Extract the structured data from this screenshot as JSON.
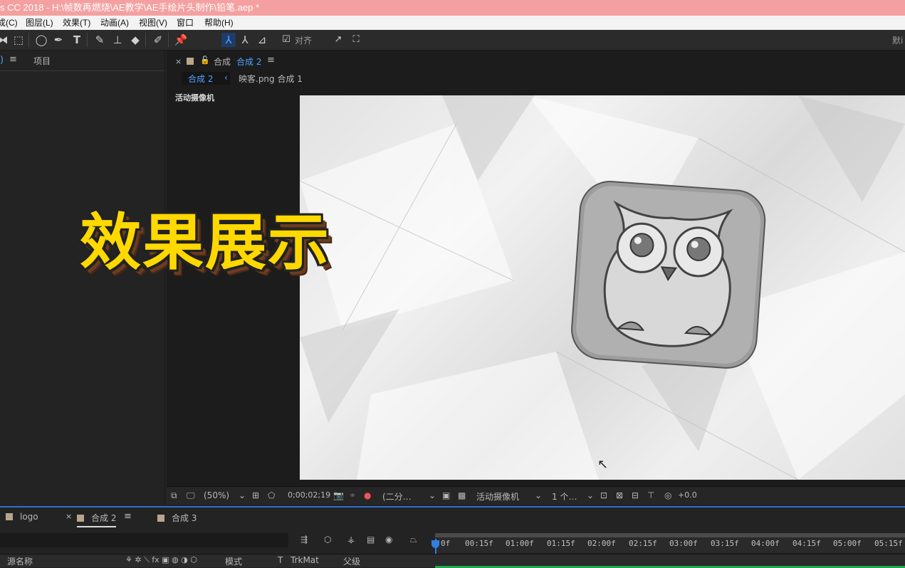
{
  "window": {
    "title": "s CC 2018 - H:\\帧数再燃烧\\AE教学\\AE手绘片头制作\\铅笔.aep *"
  },
  "menu": [
    "成(C)",
    "图层(L)",
    "效果(T)",
    "动画(A)",
    "视图(V)",
    "窗口",
    "帮助(H)"
  ],
  "toolbar": {
    "snap_label": "对齐",
    "right_label": "默i"
  },
  "left_panel": {
    "tab_label": "项目"
  },
  "comp_panel": {
    "tab_prefix": "合成",
    "tab_name": "合成 2",
    "crumbs": [
      "合成 2",
      "映客.png 合成 1"
    ],
    "camera_label": "活动摄像机",
    "overlay_text": "效果展示"
  },
  "viewer_bar": {
    "zoom": "(50%)",
    "timecode": "0;00;02;19",
    "resolution": "(二分…",
    "camera": "活动摄像机",
    "views": "1 个…",
    "exposure": "+0.0"
  },
  "timeline": {
    "tabs": [
      "logo",
      "合成 2",
      "合成 3"
    ],
    "ruler_ticks": [
      "0f",
      "00:15f",
      "01:00f",
      "01:15f",
      "02:00f",
      "02:15f",
      "03:00f",
      "03:15f",
      "04:00f",
      "04:15f",
      "05:00f",
      "05:15f"
    ],
    "headers": {
      "source_name": "源名称",
      "mode": "模式",
      "t": "T",
      "trkmat": "TrkMat",
      "parent": "父级"
    }
  },
  "colors": {
    "title_bar": "#f5a0a0",
    "accent": "#4ea3ff",
    "overlay_fill": "#ffd800",
    "label_swatch": "#b9a58a"
  }
}
